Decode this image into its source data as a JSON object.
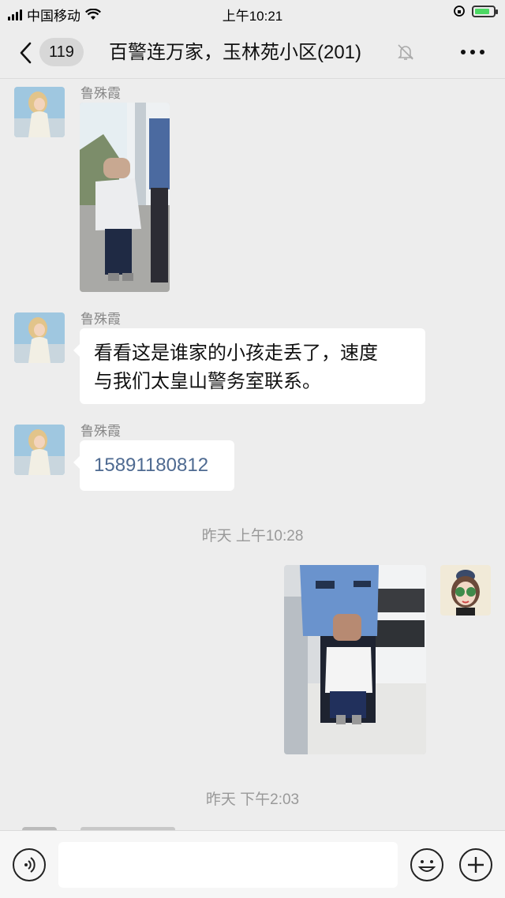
{
  "status_bar": {
    "carrier": "中国移动",
    "time": "上午10:21",
    "battery_color": "#4cd964"
  },
  "nav": {
    "back_icon": "chevron-left-icon",
    "unread_count": "119",
    "title": "百警连万家，玉林苑小区(201)",
    "mute_icon": "bell-off-icon",
    "more_icon": "more-dots-icon"
  },
  "messages": [
    {
      "type": "image",
      "sender": "鲁殊霞",
      "side": "left"
    },
    {
      "type": "text",
      "sender": "鲁殊霞",
      "side": "left",
      "text_line1": "看看这是谁家的小孩走丢了，速度",
      "text_line2": "与我们太皇山警务室联系。"
    },
    {
      "type": "text",
      "sender": "鲁殊霞",
      "side": "left",
      "text": "15891180812",
      "link_color": "#4e6a91"
    },
    {
      "type": "timestamp",
      "text": "昨天 上午10:28"
    },
    {
      "type": "image",
      "side": "right"
    },
    {
      "type": "timestamp",
      "text": "昨天 下午2:03"
    }
  ],
  "input_bar": {
    "voice_icon": "voice-icon",
    "emoji_icon": "emoji-icon",
    "plus_icon": "plus-icon",
    "placeholder": ""
  },
  "colors": {
    "background": "#ededed",
    "bubble": "#ffffff",
    "timestamp": "#999999"
  }
}
